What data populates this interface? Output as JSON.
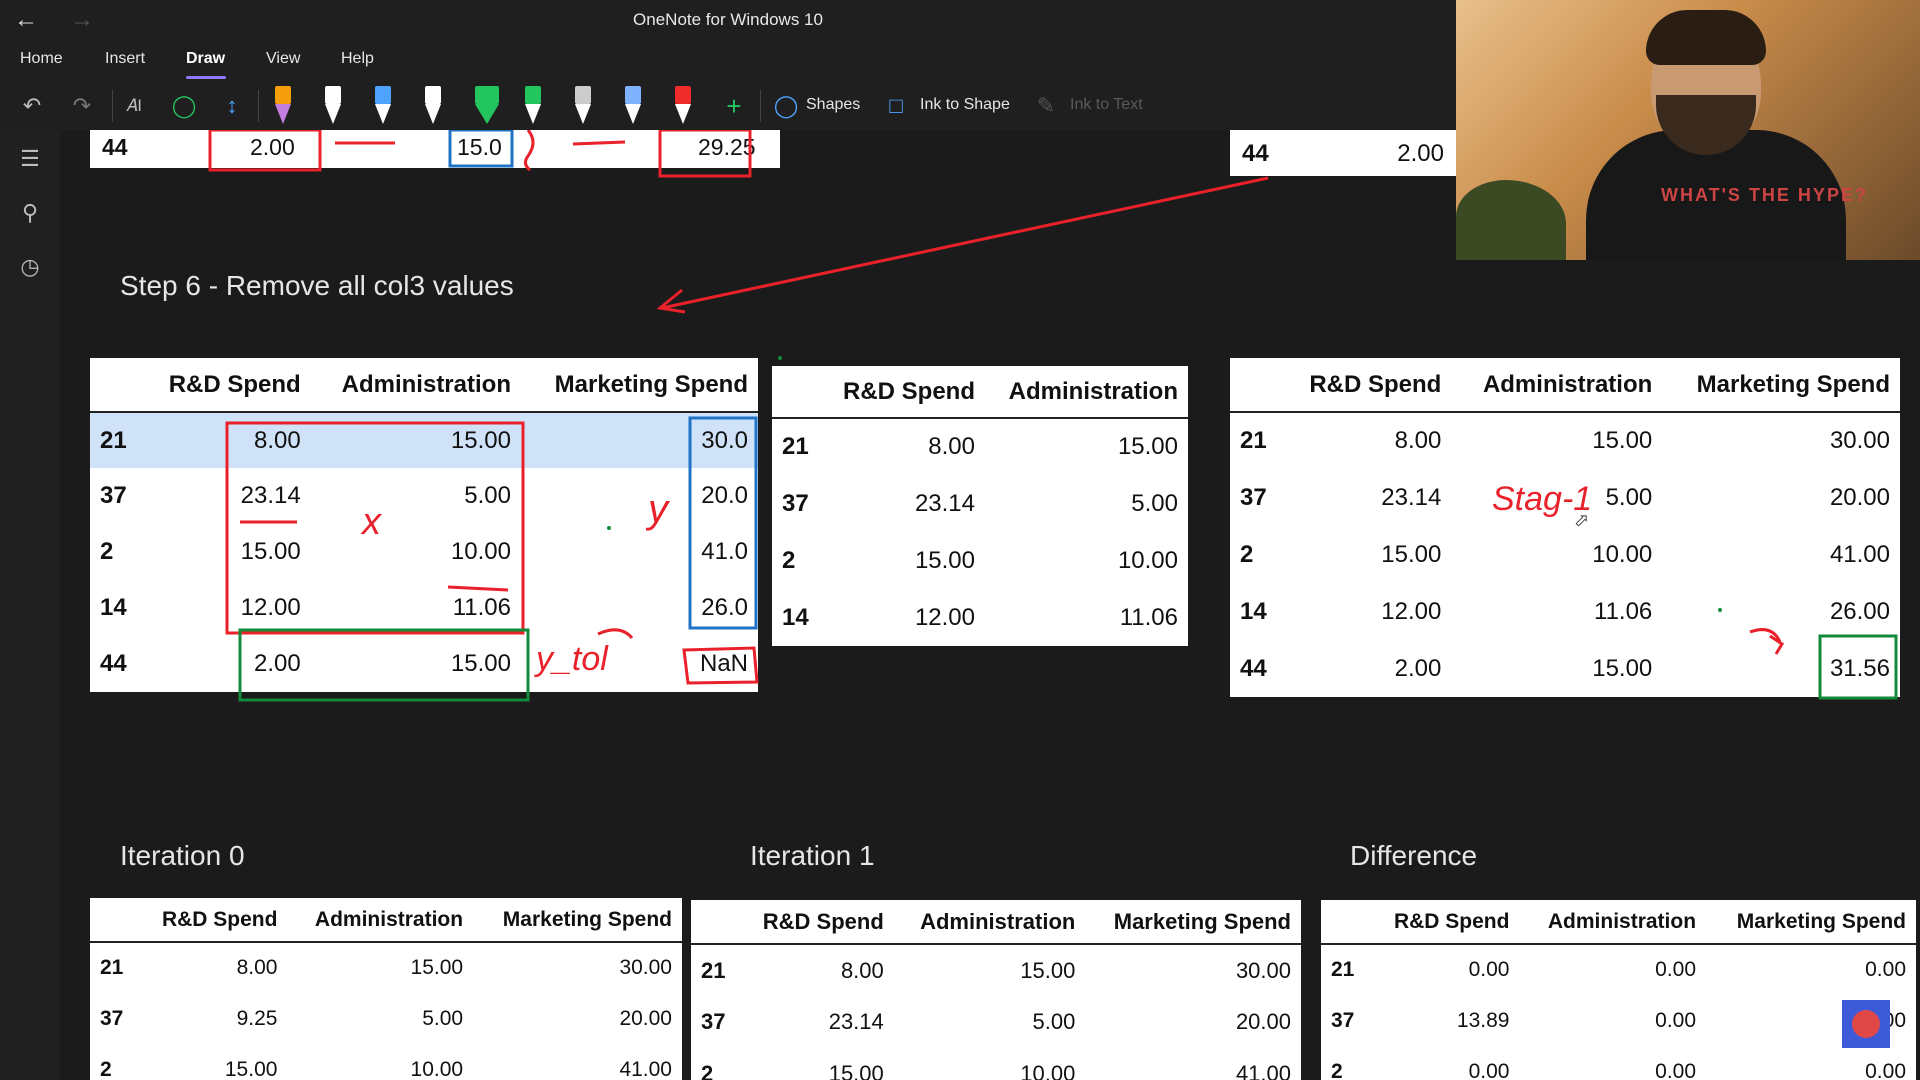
{
  "window": {
    "title": "OneNote for Windows 10"
  },
  "menu": {
    "items": [
      "Home",
      "Insert",
      "Draw",
      "View",
      "Help"
    ],
    "active": "Draw"
  },
  "ribbon": {
    "shapes_label": "Shapes",
    "ink_to_shape_label": "Ink to Shape",
    "ink_to_text_label": "Ink to Text"
  },
  "pens": [
    "#c27fe0",
    "#ffffff",
    "#4da3ff",
    "#ffffff",
    "#22c55e",
    "#22c55e",
    "#cccccc",
    "#7fb3ff",
    "#ef2b2b"
  ],
  "top_strip": {
    "index": "44",
    "v1": "2.00",
    "v2": "15.0",
    "v3": "29.25",
    "right_index": "44",
    "right_value": "2.00"
  },
  "step6": {
    "heading": "Step 6 - Remove all col3 values"
  },
  "table_a": {
    "columns": [
      "R&D Spend",
      "Administration",
      "Marketing Spend"
    ],
    "rows": [
      {
        "idx": "21",
        "c1": "8.00",
        "c2": "15.00",
        "c3": "30.0"
      },
      {
        "idx": "37",
        "c1": "23.14",
        "c2": "5.00",
        "c3": "20.0"
      },
      {
        "idx": "2",
        "c1": "15.00",
        "c2": "10.00",
        "c3": "41.0"
      },
      {
        "idx": "14",
        "c1": "12.00",
        "c2": "11.06",
        "c3": "26.0"
      },
      {
        "idx": "44",
        "c1": "2.00",
        "c2": "15.00",
        "c3": "NaN"
      }
    ]
  },
  "table_b": {
    "columns": [
      "R&D Spend",
      "Administration"
    ],
    "rows": [
      {
        "idx": "21",
        "c1": "8.00",
        "c2": "15.00"
      },
      {
        "idx": "37",
        "c1": "23.14",
        "c2": "5.00"
      },
      {
        "idx": "2",
        "c1": "15.00",
        "c2": "10.00"
      },
      {
        "idx": "14",
        "c1": "12.00",
        "c2": "11.06"
      }
    ]
  },
  "table_c": {
    "columns": [
      "R&D Spend",
      "Administration",
      "Marketing Spend"
    ],
    "rows": [
      {
        "idx": "21",
        "c1": "8.00",
        "c2": "15.00",
        "c3": "30.00"
      },
      {
        "idx": "37",
        "c1": "23.14",
        "c2": "5.00",
        "c3": "20.00"
      },
      {
        "idx": "2",
        "c1": "15.00",
        "c2": "10.00",
        "c3": "41.00"
      },
      {
        "idx": "14",
        "c1": "12.00",
        "c2": "11.06",
        "c3": "26.00"
      },
      {
        "idx": "44",
        "c1": "2.00",
        "c2": "15.00",
        "c3": "31.56"
      }
    ]
  },
  "iter0": {
    "heading": "Iteration 0",
    "columns": [
      "R&D Spend",
      "Administration",
      "Marketing Spend"
    ],
    "rows": [
      {
        "idx": "21",
        "c1": "8.00",
        "c2": "15.00",
        "c3": "30.00"
      },
      {
        "idx": "37",
        "c1": "9.25",
        "c2": "5.00",
        "c3": "20.00"
      },
      {
        "idx": "2",
        "c1": "15.00",
        "c2": "10.00",
        "c3": "41.00"
      }
    ]
  },
  "iter1": {
    "heading": "Iteration 1",
    "columns": [
      "R&D Spend",
      "Administration",
      "Marketing Spend"
    ],
    "rows": [
      {
        "idx": "21",
        "c1": "8.00",
        "c2": "15.00",
        "c3": "30.00"
      },
      {
        "idx": "37",
        "c1": "23.14",
        "c2": "5.00",
        "c3": "20.00"
      },
      {
        "idx": "2",
        "c1": "15.00",
        "c2": "10.00",
        "c3": "41.00"
      }
    ]
  },
  "diff": {
    "heading": "Difference",
    "columns": [
      "R&D Spend",
      "Administration",
      "Marketing Spend"
    ],
    "rows": [
      {
        "idx": "21",
        "c1": "0.00",
        "c2": "0.00",
        "c3": "0.00"
      },
      {
        "idx": "37",
        "c1": "13.89",
        "c2": "0.00",
        "c3": "0.00"
      },
      {
        "idx": "2",
        "c1": "0.00",
        "c2": "0.00",
        "c3": "0.00"
      }
    ]
  },
  "annotations": {
    "x_mark": "x",
    "y_mark": "y",
    "y_hat": "y_tol",
    "stage": "Stag-1"
  },
  "webcam": {
    "shirt_text": "WHAT'S THE HYPE?"
  },
  "colors": {
    "ink_red": "#e8212b",
    "ink_blue": "#1f72c4",
    "ink_green": "#128a3a"
  }
}
